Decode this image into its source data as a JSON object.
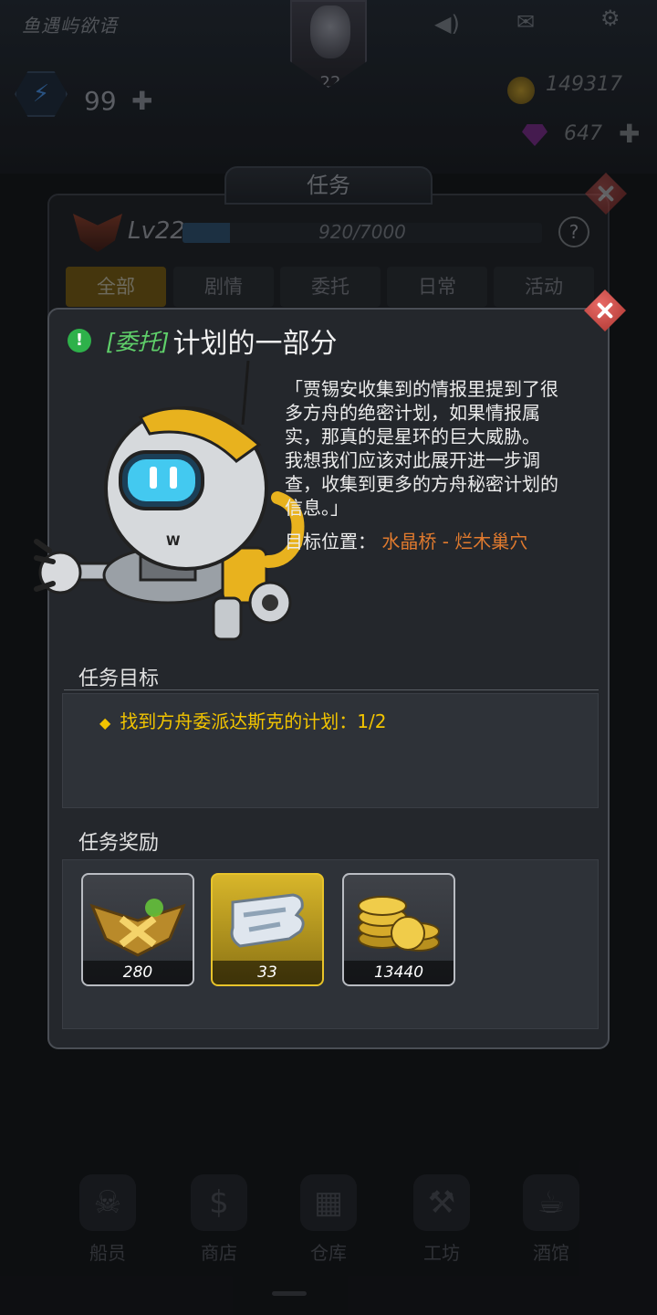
{
  "hud": {
    "player_name": "鱼遇屿欲语",
    "avatar_level": "22",
    "energy": "99",
    "gold": "149317",
    "gems": "647"
  },
  "quest_window": {
    "header": "任务",
    "level": "Lv22",
    "exp_text": "920/7000",
    "exp_fraction": 0.1314,
    "help": "?",
    "tabs": [
      "全部",
      "剧情",
      "委托",
      "日常",
      "活动"
    ],
    "active_tab": 0
  },
  "popup": {
    "title_tag": "[委托]",
    "title": "计划的一部分",
    "story_lines": [
      "「贾锡安收集到的情报里提到了很",
      "多方舟的绝密计划，如果情报属",
      "实，那真的是星环的巨大威胁。",
      "我想我们应该对此展开进一步调",
      "查，收集到更多的方舟秘密计划的",
      "信息。」"
    ],
    "target_label": "目标位置：",
    "target_value": "水晶桥 - 烂木巢穴",
    "objective_heading": "任务目标",
    "objectives": [
      "找到方舟委派达斯克的计划：1/2"
    ],
    "reward_heading": "任务奖励",
    "rewards": [
      {
        "icon": "rank-badge-icon",
        "count": "280"
      },
      {
        "icon": "weapon-fragment-icon",
        "count": "33"
      },
      {
        "icon": "gold-coins-icon",
        "count": "13440"
      }
    ]
  },
  "bottom_nav": [
    "船员",
    "商店",
    "仓库",
    "工坊",
    "酒馆"
  ],
  "colors": {
    "accent_gold": "#f2c400",
    "tag_green": "#5fd06a",
    "target_orange": "#e07a2e",
    "close_red": "#c8423d"
  }
}
